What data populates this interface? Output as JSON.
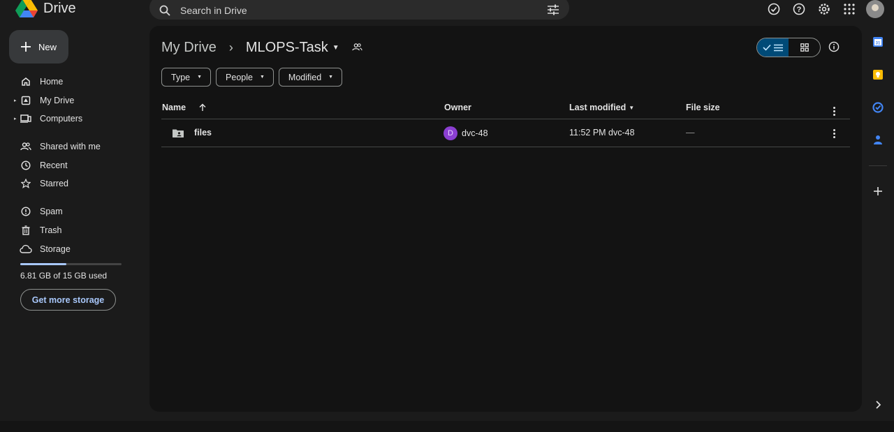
{
  "app": {
    "name": "Drive"
  },
  "search": {
    "placeholder": "Search in Drive"
  },
  "sidebar": {
    "new_label": "New",
    "items": [
      {
        "label": "Home"
      },
      {
        "label": "My Drive"
      },
      {
        "label": "Computers"
      },
      {
        "label": "Shared with me"
      },
      {
        "label": "Recent"
      },
      {
        "label": "Starred"
      },
      {
        "label": "Spam"
      },
      {
        "label": "Trash"
      },
      {
        "label": "Storage"
      }
    ],
    "storage": {
      "text": "6.81 GB of 15 GB used",
      "used_fraction": 0.454,
      "button": "Get more storage"
    }
  },
  "breadcrumb": {
    "root": "My Drive",
    "separator": "›",
    "current": "MLOPS-Task"
  },
  "filters": [
    {
      "label": "Type"
    },
    {
      "label": "People"
    },
    {
      "label": "Modified"
    }
  ],
  "table": {
    "headers": {
      "name": "Name",
      "owner": "Owner",
      "modified": "Last modified",
      "size": "File size"
    },
    "rows": [
      {
        "name": "files",
        "owner_initial": "D",
        "owner": "dvc-48",
        "modified": "11:52 PM dvc-48",
        "size": "—"
      }
    ]
  },
  "colors": {
    "accent": "#a8c7fa",
    "panel": "#131313",
    "background": "#1b1b1b",
    "avatar": "#8b3fd1"
  }
}
